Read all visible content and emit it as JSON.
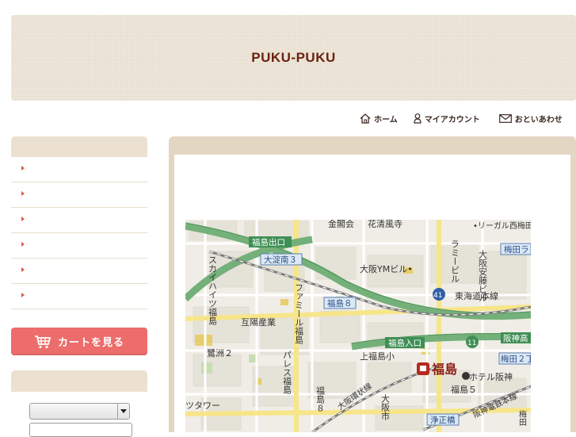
{
  "header": {
    "title": "PUKU-PUKU"
  },
  "topnav": [
    {
      "label": "ホーム",
      "icon": "home-icon"
    },
    {
      "label": "マイアカウント",
      "icon": "user-icon"
    },
    {
      "label": "おといあわせ",
      "icon": "mail-icon"
    }
  ],
  "sidebar": {
    "category_count": 6,
    "cart_button": "カートを見る"
  },
  "map": {
    "labels": {
      "kinkaku": "金閣会",
      "kasei": "花清風寺",
      "regal": "•リーガル西梅田",
      "fukushima_exit": "福島出口",
      "oyodominami": "大淀南３",
      "umeda": "梅田ラ",
      "rami": "ラミービル",
      "osaka_ym": "大阪YMビル•",
      "osaka_ando": "大阪安藤ビル",
      "sky_heights": "スカイハイツ福島",
      "famille": "ファミール福島",
      "fukushima8_sign": "福島８",
      "gochi": "互陽産業",
      "route41": "41",
      "tokaido": "東海道本線",
      "sagisu2": "鷺洲２",
      "fukushima_iriguchi": "福島入口",
      "route11": "11",
      "hanshin_hwy": "阪神高",
      "kamifukushima": "上福島小",
      "fukushima_station": "福島",
      "hotel_hanshin": "ホテル阪神",
      "umeda2": "梅田２丁",
      "palace": "パレス福島",
      "osaka_loop": "大阪環状線",
      "fukushima8": "福島８",
      "fukushima5": "福島５",
      "hanshin_rail": "阪神電鉄本線",
      "tower": "ツタワー",
      "osaka_city": "大阪市",
      "joseibashi": "浄正橋",
      "ume": "梅田"
    }
  }
}
